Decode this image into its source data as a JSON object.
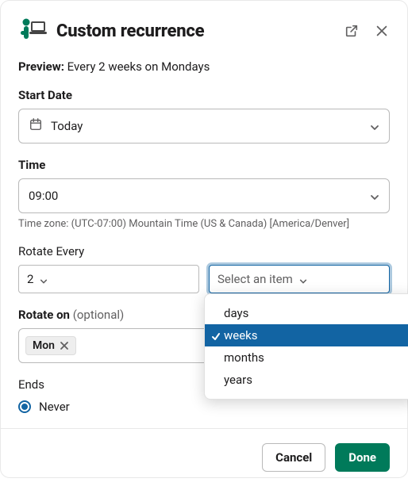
{
  "header": {
    "title": "Custom recurrence"
  },
  "preview": {
    "label": "Preview:",
    "text": "Every 2 weeks on Mondays"
  },
  "startDate": {
    "label": "Start Date",
    "value": "Today"
  },
  "time": {
    "label": "Time",
    "value": "09:00",
    "timezoneText": "Time zone: (UTC-07:00) Mountain Time (US & Canada)  [America/Denver]"
  },
  "rotateEvery": {
    "label": "Rotate Every",
    "countValue": "2",
    "unitPlaceholder": "Select an item",
    "options": {
      "0": "days",
      "1": "weeks",
      "2": "months",
      "3": "years"
    },
    "selectedIndex": 1
  },
  "rotateOn": {
    "label": "Rotate on",
    "optional": "(optional)",
    "chip": "Mon"
  },
  "ends": {
    "label": "Ends",
    "never": "Never"
  },
  "footer": {
    "cancel": "Cancel",
    "done": "Done"
  }
}
